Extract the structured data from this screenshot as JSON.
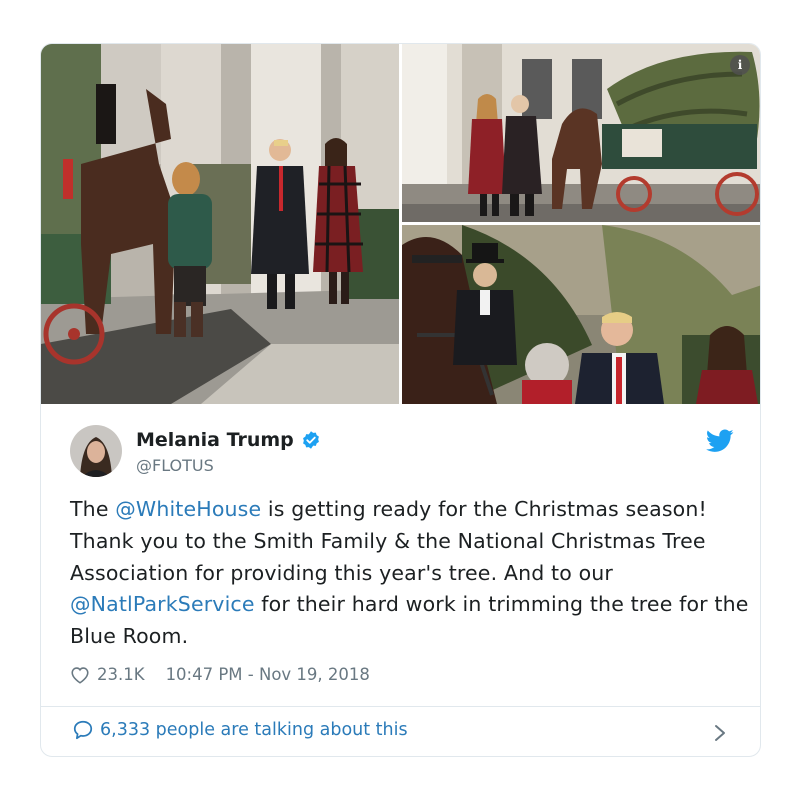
{
  "colors": {
    "link": "#2b7bb9",
    "verified": "#1da1f2",
    "muted": "#697882",
    "border": "#e1e8ed"
  },
  "icons": {
    "info": "info-icon",
    "verified": "verified-badge-icon",
    "platform": "twitter-bird-icon",
    "like": "heart-icon",
    "reply": "speech-bubble-icon",
    "more": "chevron-right-icon"
  },
  "media": {
    "info_label": "i"
  },
  "author": {
    "name": "Melania Trump",
    "handle": "@FLOTUS"
  },
  "tweet": {
    "t1": "The ",
    "mention1": "@WhiteHouse",
    "t2": " is getting ready for the Christmas season! Thank you to the Smith Family & the National Christmas Tree Association for providing this year's tree. And to our ",
    "mention2": "@NatlParkService",
    "t3": " for their hard work in trimming the tree for the Blue Room."
  },
  "stats": {
    "likes": "23.1K",
    "timestamp": "10:47 PM - Nov 19, 2018"
  },
  "conversation": {
    "label": "6,333 people are talking about this"
  }
}
